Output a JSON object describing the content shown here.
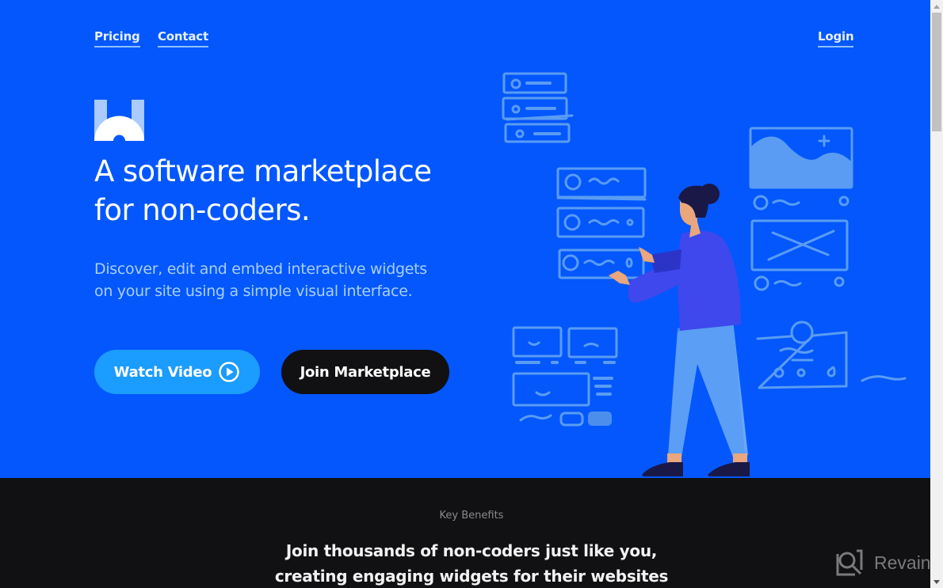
{
  "nav": {
    "pricing": "Pricing",
    "contact": "Contact",
    "login": "Login"
  },
  "hero": {
    "title_line1": "A software marketplace",
    "title_line2": "for non-coders.",
    "subtitle_line1": "Discover, edit and embed interactive widgets",
    "subtitle_line2": "on your site using a simple visual interface.",
    "watch_video_label": "Watch Video",
    "join_label": "Join Marketplace"
  },
  "benefits": {
    "kicker": "Key Benefits",
    "headline_line1": "Join thousands of non-coders just like you,",
    "headline_line2": "creating engaging widgets for their websites"
  },
  "watermark": {
    "text": "Revain"
  },
  "colors": {
    "hero_bg": "#0357fd",
    "watch_button": "#1b9cff",
    "join_button": "#111113",
    "dark_section": "#111113"
  }
}
